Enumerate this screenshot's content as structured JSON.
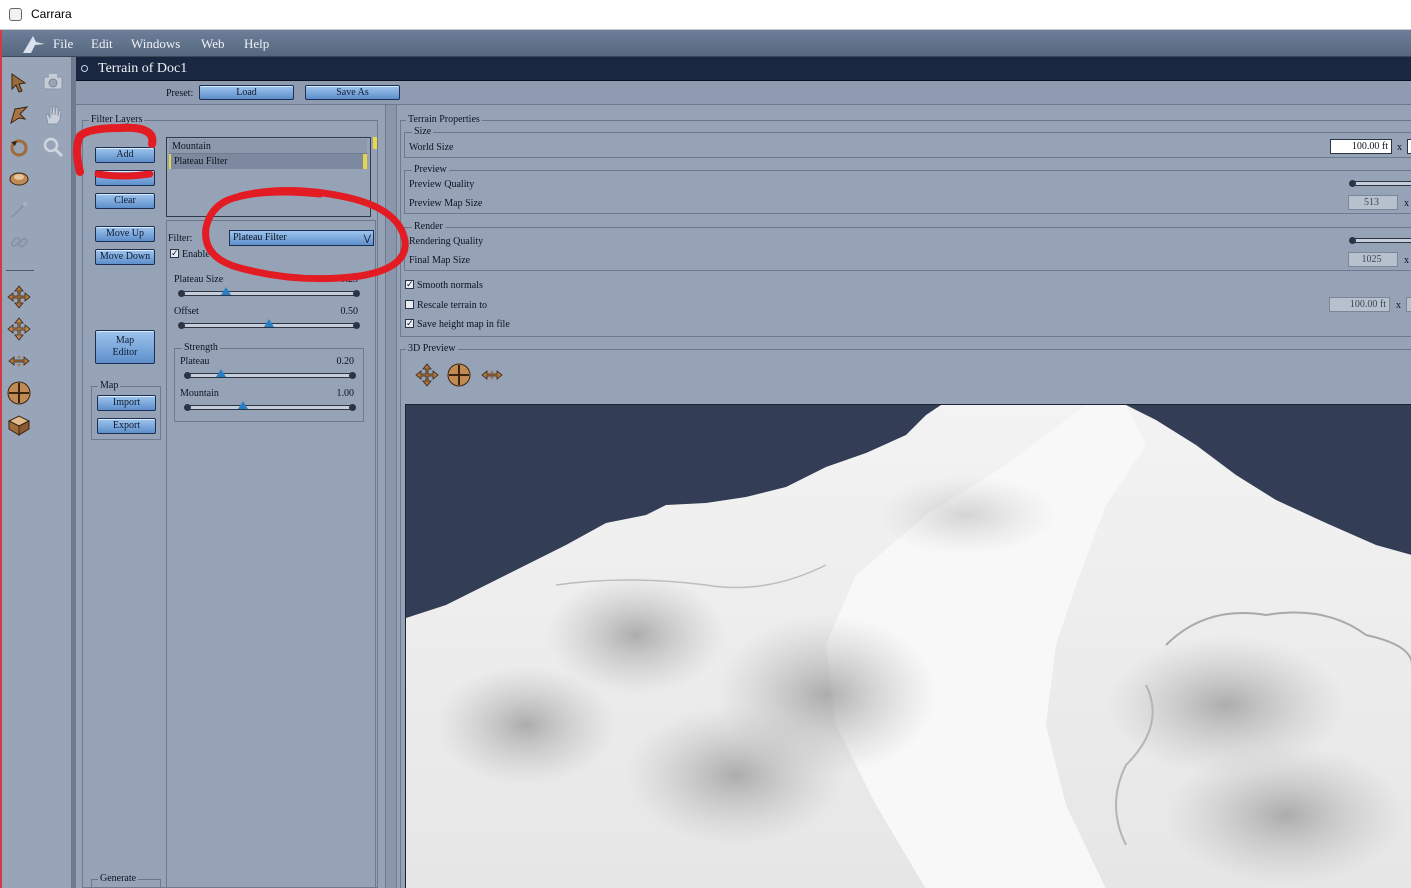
{
  "window": {
    "title": "Carrara"
  },
  "menubar": {
    "items": [
      "File",
      "Edit",
      "Windows",
      "Web",
      "Help"
    ]
  },
  "document": {
    "title": "Terrain of Doc1"
  },
  "preset": {
    "label": "Preset:",
    "load": "Load",
    "save_as": "Save As"
  },
  "filter_layers": {
    "title": "Filter Layers",
    "buttons": {
      "add": "Add",
      "clear": "Clear",
      "move_up": "Move Up",
      "move_down": "Move Down",
      "map_editor_line1": "Map",
      "map_editor_line2": "Editor"
    },
    "layers": [
      "Mountain",
      "Plateau Filter"
    ],
    "map_group": {
      "title": "Map",
      "import": "Import",
      "export": "Export"
    },
    "generate_group": {
      "title": "Generate"
    }
  },
  "filter": {
    "label": "Filter:",
    "selected": "Plateau Filter",
    "enable_label": "Enable",
    "enabled": true,
    "plateau_size": {
      "label": "Plateau Size",
      "value_text": "0.25",
      "value": 0.25
    },
    "offset": {
      "label": "Offset",
      "value_text": "0.50",
      "value": 0.5
    },
    "strength": {
      "title": "Strength",
      "plateau": {
        "label": "Plateau",
        "value_text": "0.20",
        "value": 0.2
      },
      "mountain": {
        "label": "Mountain",
        "value_text": "1.00",
        "value": 1.0
      }
    }
  },
  "terrain_properties": {
    "title": "Terrain Properties",
    "size": {
      "title": "Size",
      "world_size_label": "World Size",
      "world_size_value": "100.00 ft",
      "x": "x"
    },
    "preview": {
      "title": "Preview",
      "quality_label": "Preview Quality",
      "map_size_label": "Preview Map Size",
      "map_size_value": "513",
      "x": "x"
    },
    "render": {
      "title": "Render",
      "quality_label": "Rendering Quality",
      "map_size_label": "Final Map Size",
      "map_size_value": "1025",
      "x": "x"
    },
    "smooth_normals": {
      "label": "Smooth normals",
      "checked": true
    },
    "rescale": {
      "label": "Rescale terrain to",
      "checked": false,
      "value": "100.00 ft",
      "x": "x"
    },
    "save_height_map": {
      "label": "Save height map in file",
      "checked": true
    }
  },
  "preview_3d": {
    "title": "3D Preview"
  },
  "colors": {
    "chrome": "#96a2b6",
    "menubar": "#5f7088",
    "doc_header": "#1a2740",
    "button": "#6d9dd6",
    "annotation": "#e31b23",
    "viewport_sky": "#333d55"
  }
}
